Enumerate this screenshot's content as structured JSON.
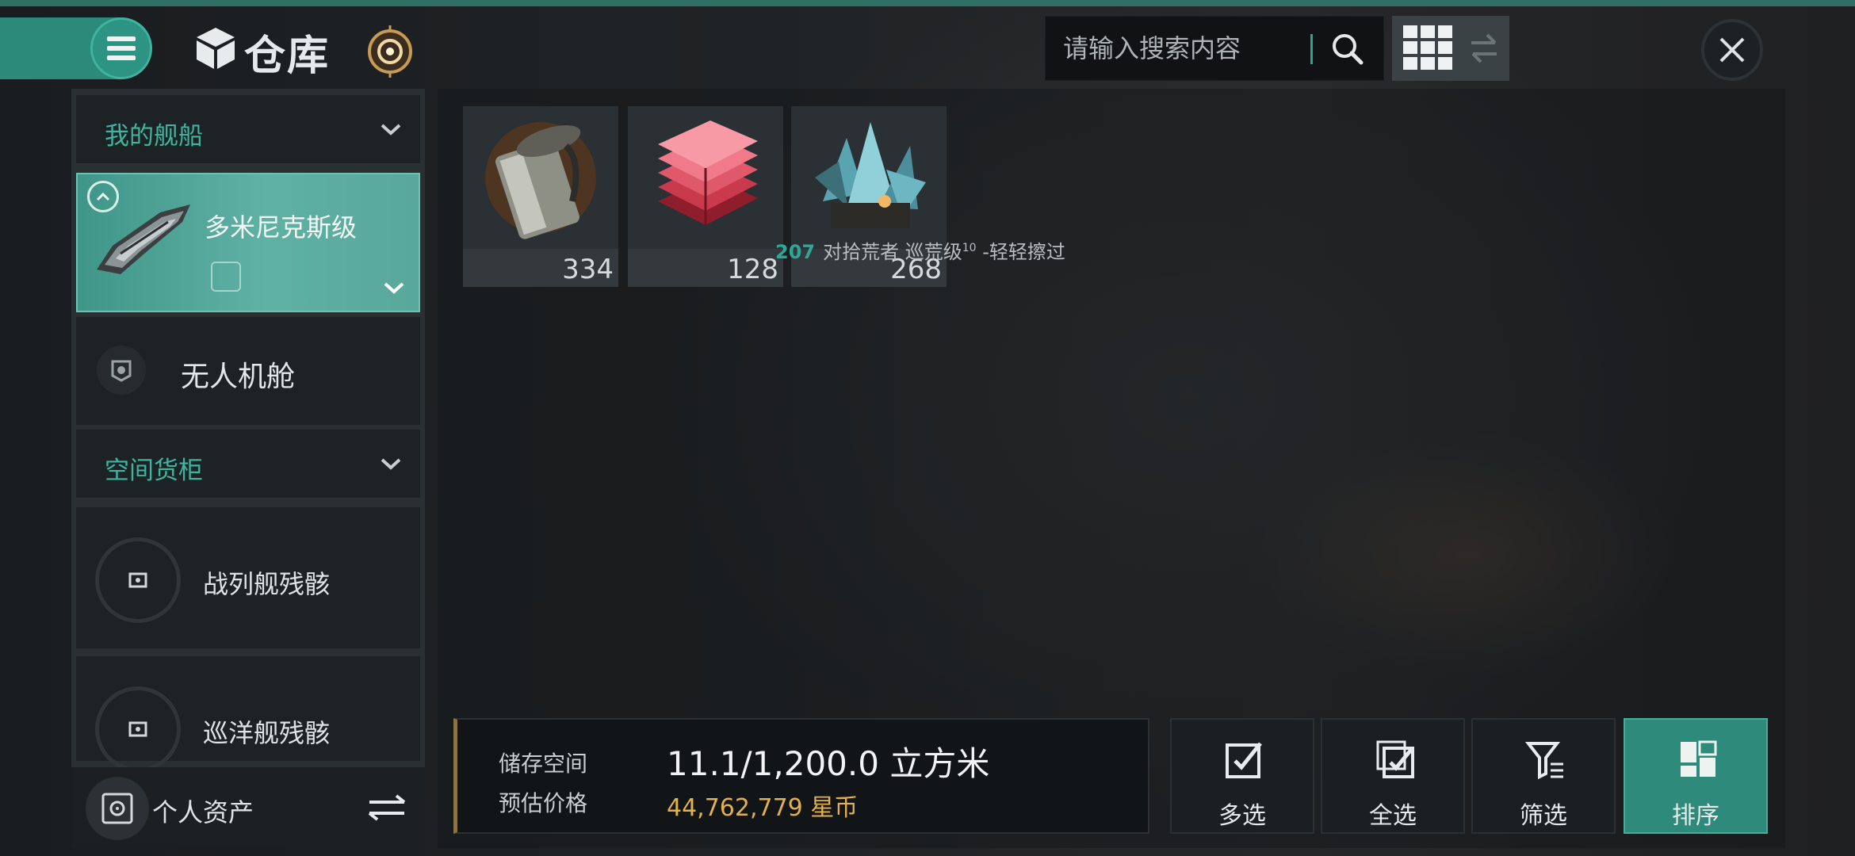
{
  "header": {
    "title": "仓库",
    "search": {
      "placeholder": "请输入搜索内容"
    }
  },
  "sidebar": {
    "section_ships": "我的舰船",
    "selected_ship": "多米尼克斯级",
    "drone_bay": "无人机舱",
    "section_containers": "空间货柜",
    "wrecks": [
      "战列舰残骸",
      "巡洋舰残骸"
    ],
    "assets": "个人资产"
  },
  "items": [
    {
      "icon": "canister-icon",
      "qty": "334"
    },
    {
      "icon": "red-ingots-icon",
      "qty": "128"
    },
    {
      "icon": "crystal-ore-icon",
      "qty": "268"
    }
  ],
  "tooltip": {
    "number": "207",
    "text": "对拾荒者 巡荒级",
    "superscript": "10",
    "suffix": "-轻轻擦过"
  },
  "storage": {
    "space_label": "储存空间",
    "space_value": "11.1/1,200.0 立方米",
    "price_label": "预估价格",
    "price_value": "44,762,779 星币"
  },
  "actions": [
    "多选",
    "全选",
    "筛选",
    "排序"
  ],
  "colors": {
    "accent": "#2e8a7b",
    "highlight_text": "#3fb49f",
    "price": "#e3b04e"
  }
}
